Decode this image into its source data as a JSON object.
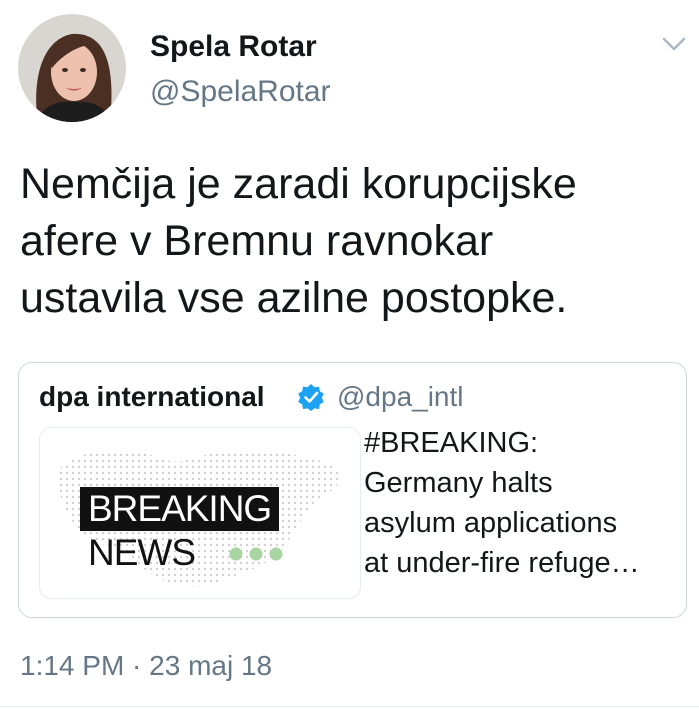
{
  "author": {
    "display_name": "Spela Rotar",
    "handle": "@SpelaRotar",
    "avatar_icon": "user-avatar"
  },
  "menu": {
    "icon": "chevron-down-icon"
  },
  "tweet": {
    "text_lines": [
      "Nemčija je zaradi korupcijske",
      "afere v Bremnu ravnokar",
      "ustavila vse azilne postopke."
    ],
    "timestamp": "1:14 PM · 23 maj 18"
  },
  "quoted_tweet": {
    "author_name": "dpa international",
    "verified": true,
    "verified_icon": "verified-badge-icon",
    "handle": "@dpa_intl",
    "text_lines": [
      "#BREAKING:",
      "Germany halts",
      "asylum applications",
      "at under-fire refuge…"
    ],
    "media": {
      "banner_text": "BREAKING",
      "news_text": "NEWS"
    }
  },
  "colors": {
    "text_primary": "#14171a",
    "text_secondary": "#657786",
    "border": "#ccd6dd",
    "verified_blue": "#1da1f2",
    "dots_green": "#a8d5a2"
  }
}
